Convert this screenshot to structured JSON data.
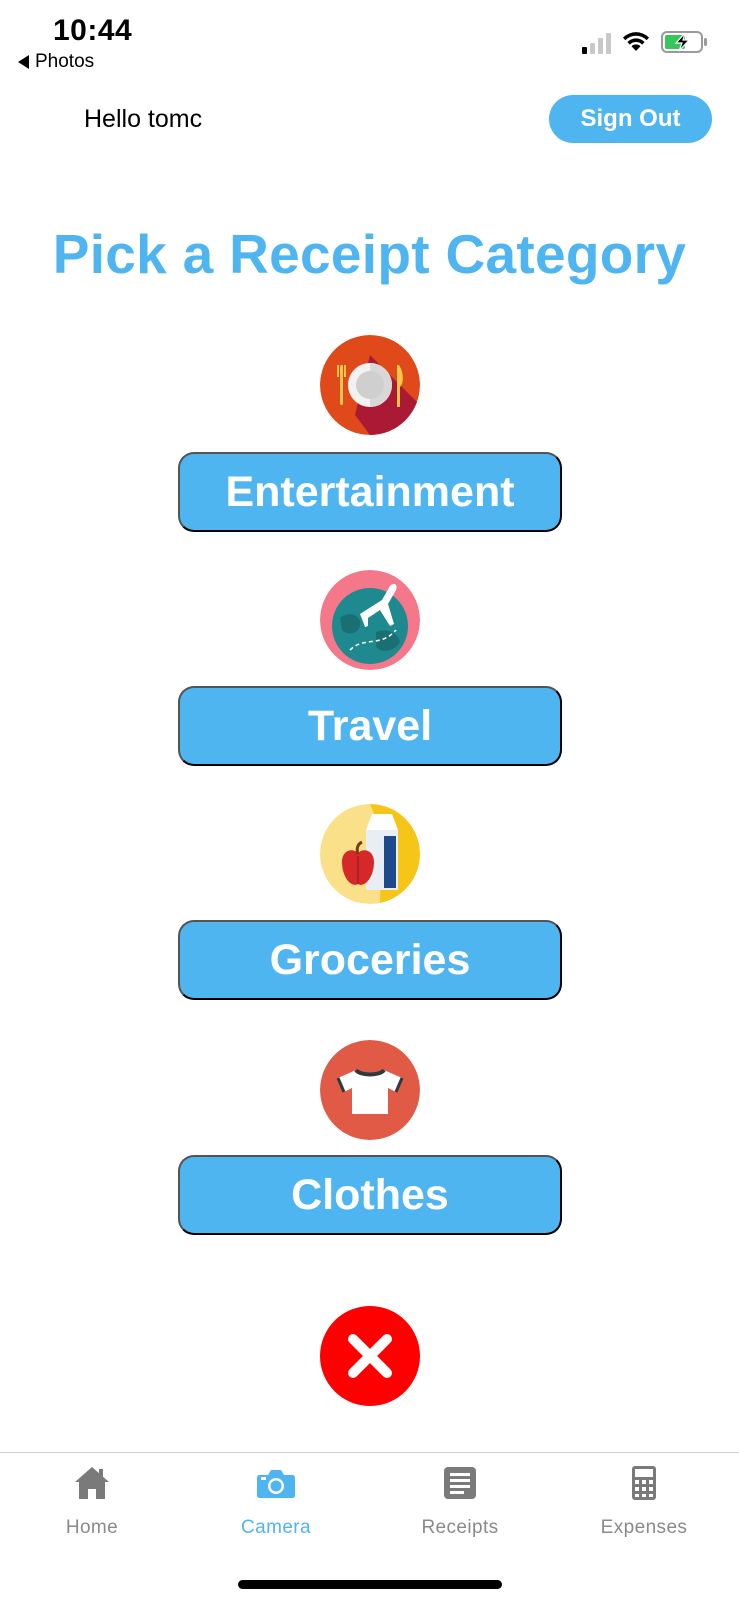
{
  "status_bar": {
    "time": "10:44",
    "back_label": "Photos",
    "battery_color": "#34c759"
  },
  "header": {
    "greeting": "Hello tomc",
    "sign_out_label": "Sign Out"
  },
  "title": "Pick a Receipt Category",
  "categories": [
    {
      "label": "Entertainment",
      "icon": "dining-plate-icon"
    },
    {
      "label": "Travel",
      "icon": "globe-airplane-icon"
    },
    {
      "label": "Groceries",
      "icon": "groceries-icon"
    },
    {
      "label": "Clothes",
      "icon": "tshirt-icon"
    }
  ],
  "cancel": {
    "icon": "close-icon",
    "color": "#ff0000"
  },
  "tab_bar": {
    "active_color": "#4fb5f0",
    "inactive_color": "#8a8a8a",
    "tabs": [
      {
        "label": "Home",
        "icon": "home-icon",
        "active": false
      },
      {
        "label": "Camera",
        "icon": "camera-icon",
        "active": true
      },
      {
        "label": "Receipts",
        "icon": "receipts-icon",
        "active": false
      },
      {
        "label": "Expenses",
        "icon": "calculator-icon",
        "active": false
      }
    ]
  },
  "accent_color": "#4fb5f0"
}
